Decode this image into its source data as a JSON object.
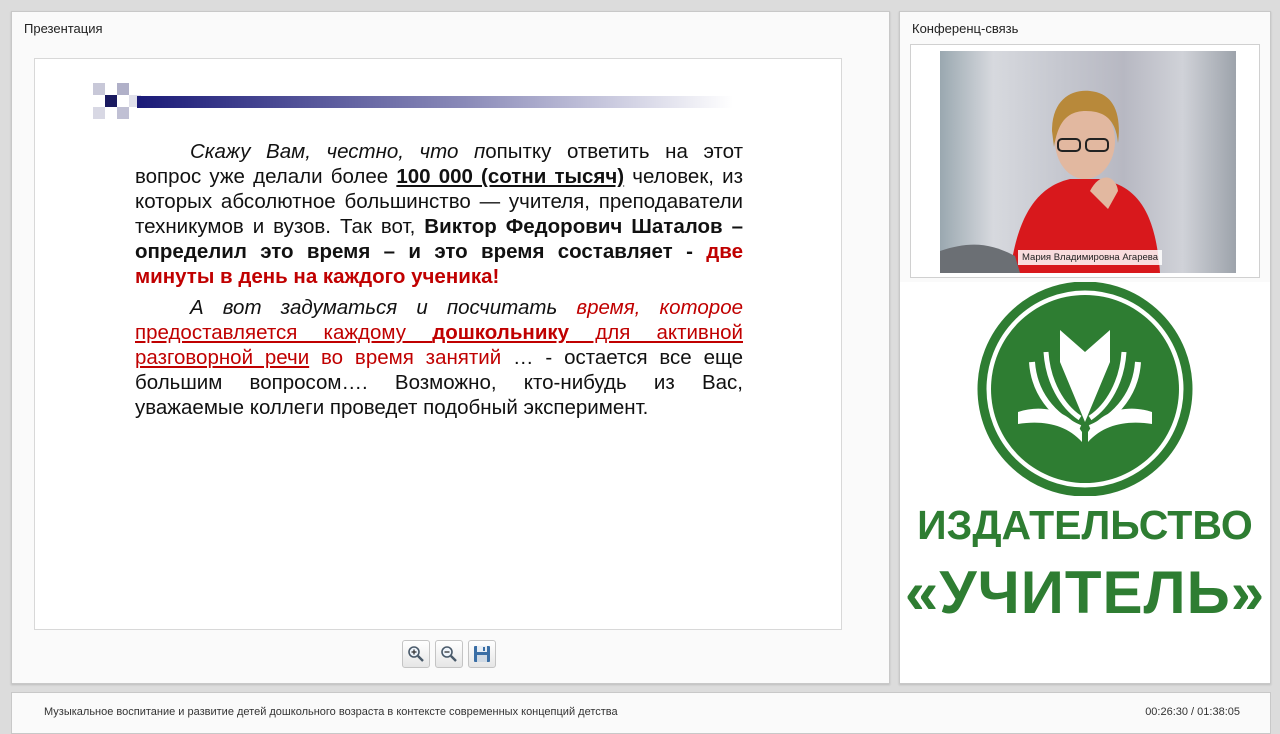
{
  "presentation_panel": {
    "title": "Презентация"
  },
  "conference_panel": {
    "title": "Конференц-связь"
  },
  "slide": {
    "p1_a": "Скажу Вам, честно, что п",
    "p1_b": "опытку ответить на этот вопрос уже делали более ",
    "p1_c": "100 000 (сотни тысяч)",
    "p1_d": " человек, из которых абсолютное большинство — учителя, преподаватели техникумов и вузов. Так вот, ",
    "p1_e": "Виктор Федорович Шаталов – определил это время – и это время составляет - ",
    "p1_f": "две минуты в день на каждого ученика!",
    "p2_a": "А вот задуматься и посчитать ",
    "p2_b": "время, которое",
    "p2_c": "предоставляется каждому ",
    "p2_d": "дошкольнику",
    "p2_e": " для активной разговорной речи",
    "p2_f": " во время занятий",
    "p2_g": " … - остается все еще большим вопросом…. Возможно, кто-нибудь из Вас, уважаемые коллеги проведет подобный эксперимент."
  },
  "toolbar": {
    "zoom_in": "zoom-in-icon",
    "zoom_out": "zoom-out-icon",
    "save": "save-icon"
  },
  "video": {
    "participant_name": "Мария Владимировна Агарева"
  },
  "logo": {
    "line1": "ИЗДАТЕЛЬСТВО",
    "line2": "«УЧИТЕЛЬ»"
  },
  "footer": {
    "title": "Музыкальное воспитание и развитие детей дошкольного возраста в контексте современных концепций детства",
    "time": "00:26:30 / 01:38:05"
  },
  "colors": {
    "brand_green": "#2e7d32",
    "slide_red": "#c00000"
  }
}
